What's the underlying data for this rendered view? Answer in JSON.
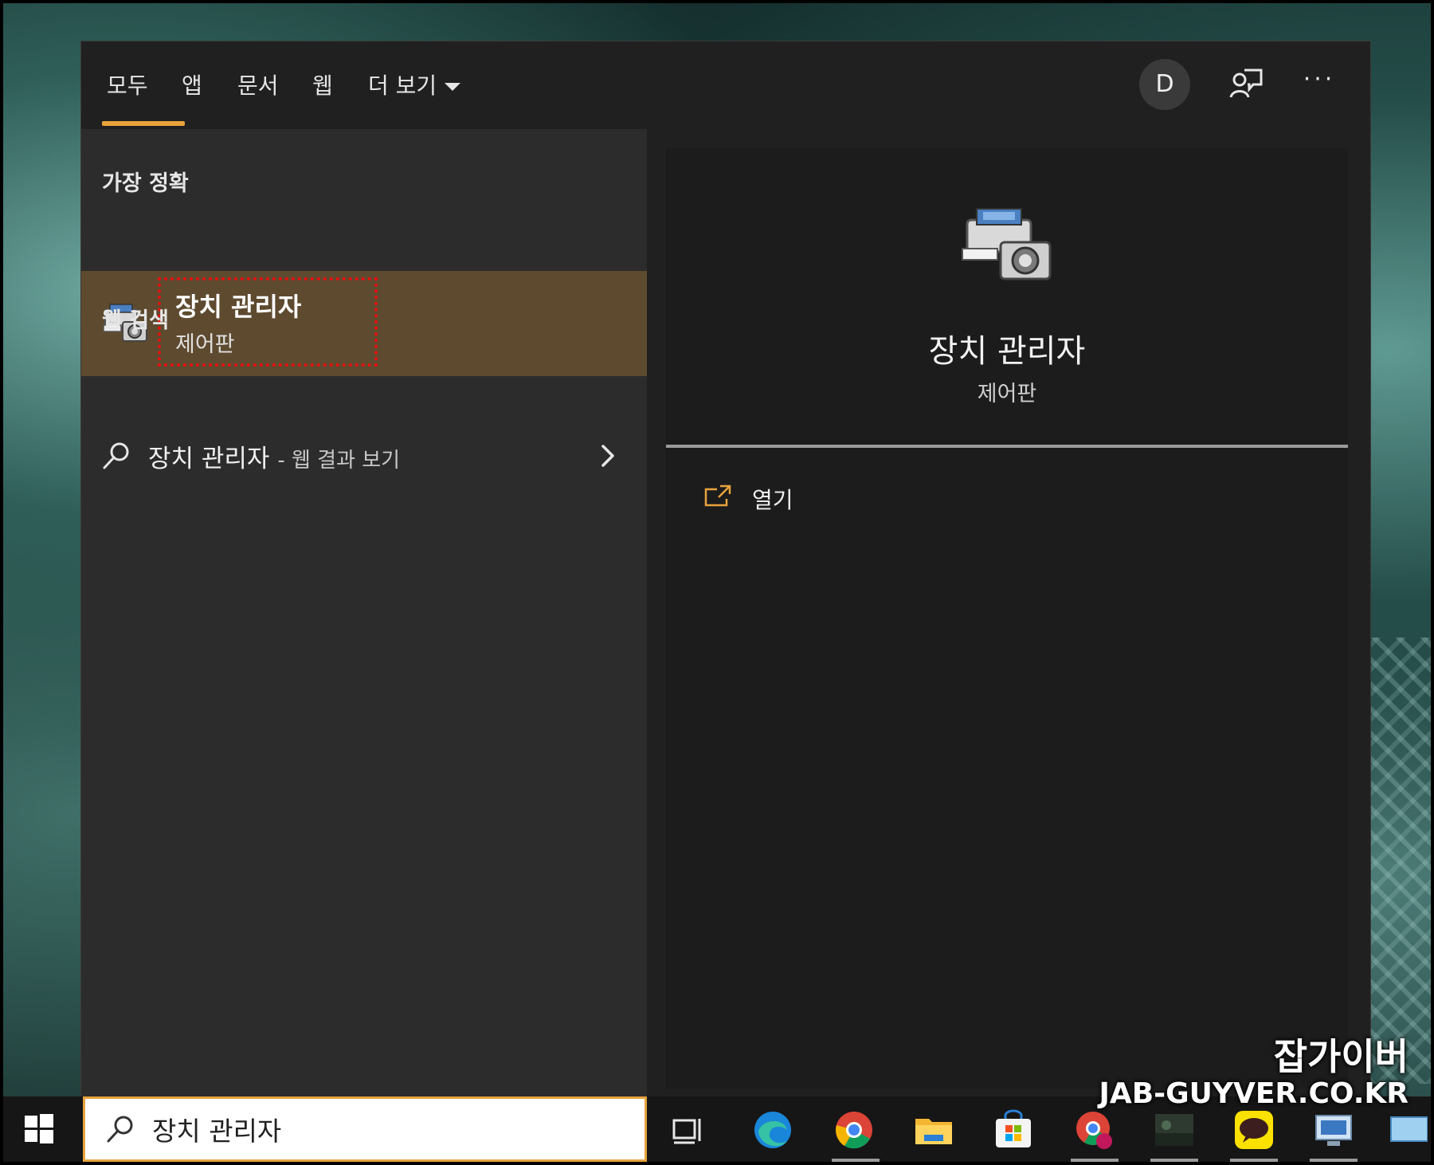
{
  "tabs": [
    {
      "label": "모두"
    },
    {
      "label": "앱"
    },
    {
      "label": "문서"
    },
    {
      "label": "웹"
    },
    {
      "label": "더 보기"
    }
  ],
  "header": {
    "avatar_initial": "D",
    "more_label": "···"
  },
  "best_match": {
    "section_label": "가장 정확",
    "title": "장치 관리자",
    "subtitle": "제어판"
  },
  "web_search": {
    "section_label": "웹 검색",
    "query": "장치 관리자",
    "suffix": "- 웹 결과 보기"
  },
  "detail": {
    "title": "장치 관리자",
    "subtitle": "제어판",
    "actions": [
      {
        "label": "열기",
        "icon": "open-external-icon"
      }
    ]
  },
  "search_box": {
    "value": "장치 관리자"
  },
  "taskbar_apps": [
    {
      "name": "task-view-icon"
    },
    {
      "name": "edge-icon"
    },
    {
      "name": "chrome-icon"
    },
    {
      "name": "file-explorer-icon"
    },
    {
      "name": "microsoft-store-icon"
    },
    {
      "name": "chrome-profile-icon"
    },
    {
      "name": "game-app-icon"
    },
    {
      "name": "kakaotalk-icon"
    },
    {
      "name": "monitor-app-icon"
    },
    {
      "name": "screen-app-icon"
    }
  ],
  "watermark": {
    "korean": "잡가이버",
    "english": "JAB-GUYVER.CO.KR"
  },
  "colors": {
    "accent": "#e8a33d",
    "selected_bg": "#5e4a2f",
    "annotation_red": "#e81010"
  }
}
